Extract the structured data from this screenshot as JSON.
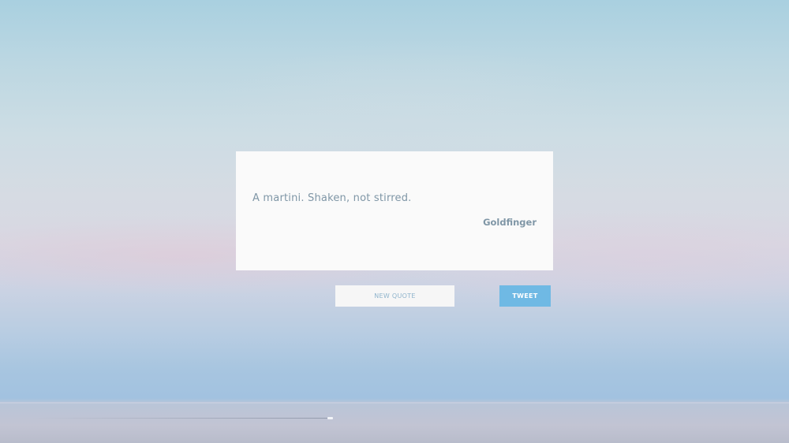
{
  "quote": {
    "text": "A martini. Shaken, not stirred.",
    "author": "Goldfinger"
  },
  "actions": {
    "new_quote_label": "NEW QUOTE",
    "tweet_label": "TWEET"
  },
  "colors": {
    "quote_text": "#7f96a6",
    "card_background": "#fafafa",
    "new_quote_background": "#f6f6f6",
    "new_quote_text": "#8fb4cc",
    "tweet_background": "#6fb9e4",
    "tweet_text": "#ffffff"
  }
}
